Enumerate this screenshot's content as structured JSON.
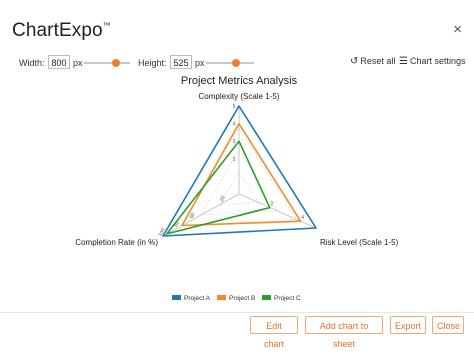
{
  "app": {
    "brand": "ChartExpo",
    "brand_mark": "™",
    "close_label": "×"
  },
  "toolbar": {
    "width_label": "Width:",
    "width_value": "800",
    "width_unit": "px",
    "height_label": "Height:",
    "height_value": "525",
    "height_unit": "px",
    "reset_icon": "reset-icon",
    "reset_label": "Reset all",
    "settings_icon": "settings-sliders-icon",
    "settings_label": "Chart settings",
    "slider_color": "#f07f2a"
  },
  "footer": {
    "edit_label": "Edit chart",
    "add_label": "Add chart to sheet",
    "export_label": "Export",
    "close_label": "Close"
  },
  "chart_data": {
    "type": "radar",
    "title": "Project Metrics Analysis",
    "axes": [
      "Complexity (Scale 1-5)",
      "Risk Level (Scale 1-5)",
      "Completion Rate (in %)"
    ],
    "axis_ranges": [
      [
        0,
        5
      ],
      [
        0,
        5
      ],
      [
        0,
        100
      ]
    ],
    "tick_labels": {
      "complexity": [
        "2",
        "3",
        "4",
        "5"
      ],
      "risk": [
        "2",
        "4"
      ],
      "completion": [
        "20",
        "60",
        "80",
        "100"
      ]
    },
    "series": [
      {
        "name": "Project A",
        "color": "#1f77b4",
        "values": [
          5,
          5,
          100
        ]
      },
      {
        "name": "Project B",
        "color": "#f28c28",
        "values": [
          4,
          4,
          75
        ]
      },
      {
        "name": "Project C",
        "color": "#2ca02c",
        "values": [
          3,
          2,
          95
        ]
      }
    ],
    "legend_position": "bottom",
    "grid": true
  }
}
